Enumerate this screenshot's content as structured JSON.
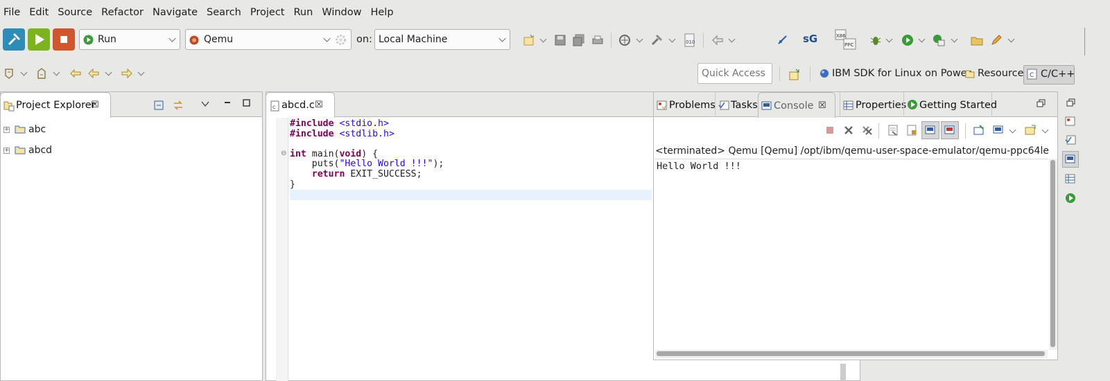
{
  "menu": [
    "File",
    "Edit",
    "Source",
    "Refactor",
    "Navigate",
    "Search",
    "Project",
    "Run",
    "Window",
    "Help"
  ],
  "toolbar": {
    "mode_value": "Run",
    "target_value": "Qemu",
    "on_label": "on:",
    "location_value": "Local Machine",
    "sg_label": "sG",
    "x86_label": "X86",
    "ppc_label": "PPC",
    "bin_label": "010"
  },
  "quick_access": {
    "placeholder": "Quick Access"
  },
  "perspectives": [
    {
      "label": "IBM SDK for Linux on Power"
    },
    {
      "label": "Resource"
    },
    {
      "label": "C/C++"
    }
  ],
  "project_explorer": {
    "title": "Project Explorer",
    "items": [
      {
        "label": "abc"
      },
      {
        "label": "abcd"
      }
    ]
  },
  "editor": {
    "tab_label": "abcd.c",
    "lines": {
      "l1_kw": "#include",
      "l1_str": "<stdio.h>",
      "l2_kw": "#include",
      "l2_str": "<stdlib.h>",
      "l4_kw1": "int",
      "l4_mid": " main(",
      "l4_kw2": "void",
      "l4_end": ") {",
      "l5_a": "    puts(",
      "l5_str": "\"Hello World !!!\"",
      "l5_b": ");",
      "l6_kw": "    return",
      "l6_b": " EXIT_SUCCESS;",
      "l7": "}"
    }
  },
  "bottom_views": {
    "tabs": [
      {
        "label": "Problems"
      },
      {
        "label": "Tasks"
      },
      {
        "label": "Console"
      },
      {
        "label": "Properties"
      },
      {
        "label": "Getting Started"
      }
    ],
    "console_header": "<terminated> Qemu [Qemu] /opt/ibm/qemu-user-space-emulator/qemu-ppc64le",
    "console_output": "Hello World !!!"
  },
  "colors": {
    "build_button": "#2d8cb8",
    "run_button": "#7bb41f",
    "stop_button": "#d2562b",
    "keyword": "#7f0055",
    "string": "#2a00ff"
  }
}
